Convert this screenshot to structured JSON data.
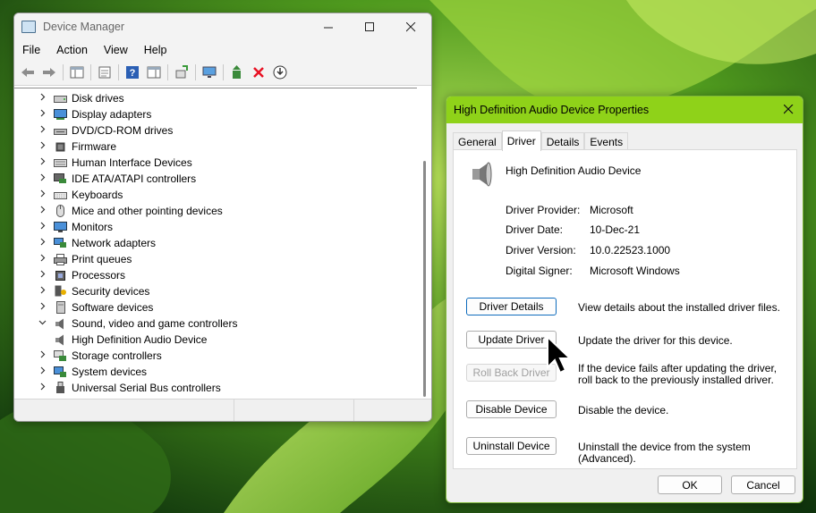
{
  "device_manager": {
    "title": "Device Manager",
    "menu": [
      "File",
      "Action",
      "View",
      "Help"
    ],
    "categories": [
      {
        "label": "Disk drives",
        "icon": "disk-drive-icon",
        "expanded": false
      },
      {
        "label": "Display adapters",
        "icon": "display-adapter-icon",
        "expanded": false
      },
      {
        "label": "DVD/CD-ROM drives",
        "icon": "dvd-drive-icon",
        "expanded": false
      },
      {
        "label": "Firmware",
        "icon": "firmware-icon",
        "expanded": false
      },
      {
        "label": "Human Interface Devices",
        "icon": "hid-icon",
        "expanded": false
      },
      {
        "label": "IDE ATA/ATAPI controllers",
        "icon": "ide-controller-icon",
        "expanded": false
      },
      {
        "label": "Keyboards",
        "icon": "keyboard-icon",
        "expanded": false
      },
      {
        "label": "Mice and other pointing devices",
        "icon": "mouse-icon",
        "expanded": false
      },
      {
        "label": "Monitors",
        "icon": "monitor-icon",
        "expanded": false
      },
      {
        "label": "Network adapters",
        "icon": "network-adapter-icon",
        "expanded": false
      },
      {
        "label": "Print queues",
        "icon": "printer-icon",
        "expanded": false
      },
      {
        "label": "Processors",
        "icon": "processor-icon",
        "expanded": false
      },
      {
        "label": "Security devices",
        "icon": "security-device-icon",
        "expanded": false
      },
      {
        "label": "Software devices",
        "icon": "software-device-icon",
        "expanded": false
      },
      {
        "label": "Sound, video and game controllers",
        "icon": "speaker-icon",
        "expanded": true
      },
      {
        "label": "High Definition Audio Device",
        "icon": "speaker-icon",
        "child": true
      },
      {
        "label": "Storage controllers",
        "icon": "storage-controller-icon",
        "expanded": false
      },
      {
        "label": "System devices",
        "icon": "system-device-icon",
        "expanded": false
      },
      {
        "label": "Universal Serial Bus controllers",
        "icon": "usb-icon",
        "expanded": false
      }
    ]
  },
  "properties": {
    "title": "High Definition Audio Device Properties",
    "tabs": [
      "General",
      "Driver",
      "Details",
      "Events"
    ],
    "active_tab": "Driver",
    "device_name": "High Definition Audio Device",
    "info": [
      {
        "label": "Driver Provider:",
        "value": "Microsoft"
      },
      {
        "label": "Driver Date:",
        "value": "10-Dec-21"
      },
      {
        "label": "Driver Version:",
        "value": "10.0.22523.1000"
      },
      {
        "label": "Digital Signer:",
        "value": "Microsoft Windows"
      }
    ],
    "actions": [
      {
        "button": "Driver Details",
        "description": "View details about the installed driver files.",
        "enabled": true
      },
      {
        "button": "Update Driver",
        "description": "Update the driver for this device.",
        "enabled": true
      },
      {
        "button": "Roll Back Driver",
        "description": "If the device fails after updating the driver, roll back to the previously installed driver.",
        "enabled": false
      },
      {
        "button": "Disable Device",
        "description": "Disable the device.",
        "enabled": true
      },
      {
        "button": "Uninstall Device",
        "description": "Uninstall the device from the system (Advanced).",
        "enabled": true
      }
    ],
    "ok_label": "OK",
    "cancel_label": "Cancel"
  },
  "colors": {
    "dialog_titlebar": "#8fd219",
    "focus_border": "#0f6cbd",
    "delete_icon": "#e81123"
  }
}
